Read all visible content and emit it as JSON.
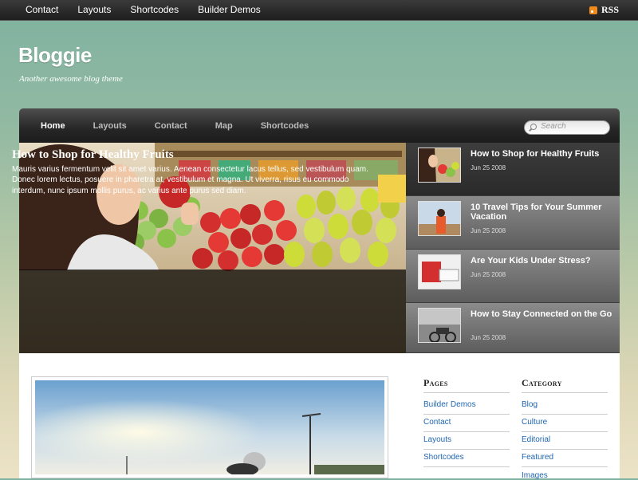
{
  "topbar": {
    "links": [
      "Contact",
      "Layouts",
      "Shortcodes",
      "Builder Demos"
    ],
    "rss_label": "RSS"
  },
  "site": {
    "title": "Bloggie",
    "tagline": "Another awesome blog theme"
  },
  "mainnav": {
    "items": [
      "Home",
      "Layouts",
      "Contact",
      "Map",
      "Shortcodes"
    ],
    "active": "Home",
    "search_placeholder": "Search"
  },
  "featured": {
    "title": "How to Shop for Healthy Fruits",
    "excerpt": "Mauris varius fermentum velit sit amet varius. Aenean consectetur lacus tellus, sed vestibulum quam. Donec lorem lectus, posuere in pharetra at, vestibulum et magna. Ut viverra, risus eu commodo interdum, nunc ipsum mollis purus, ac varius ante purus sed diam."
  },
  "side_posts": [
    {
      "title": "How to Shop for Healthy Fruits",
      "date": "Jun 25 2008"
    },
    {
      "title": "10 Travel Tips for Your Summer Vacation",
      "date": "Jun 25 2008"
    },
    {
      "title": "Are Your Kids Under Stress?",
      "date": "Jun 25 2008"
    },
    {
      "title": "How to Stay Connected on the Go",
      "date": "Jun 25 2008"
    }
  ],
  "widgets": {
    "pages": {
      "title": "Pages",
      "links": [
        "Builder Demos",
        "Contact",
        "Layouts",
        "Shortcodes"
      ]
    },
    "category": {
      "title": "Category",
      "links": [
        "Blog",
        "Culture",
        "Editorial",
        "Featured",
        "Images"
      ]
    }
  },
  "colors": {
    "link": "#1f66b0",
    "nav_bg": "#262626",
    "rss": "#f08a1c"
  }
}
